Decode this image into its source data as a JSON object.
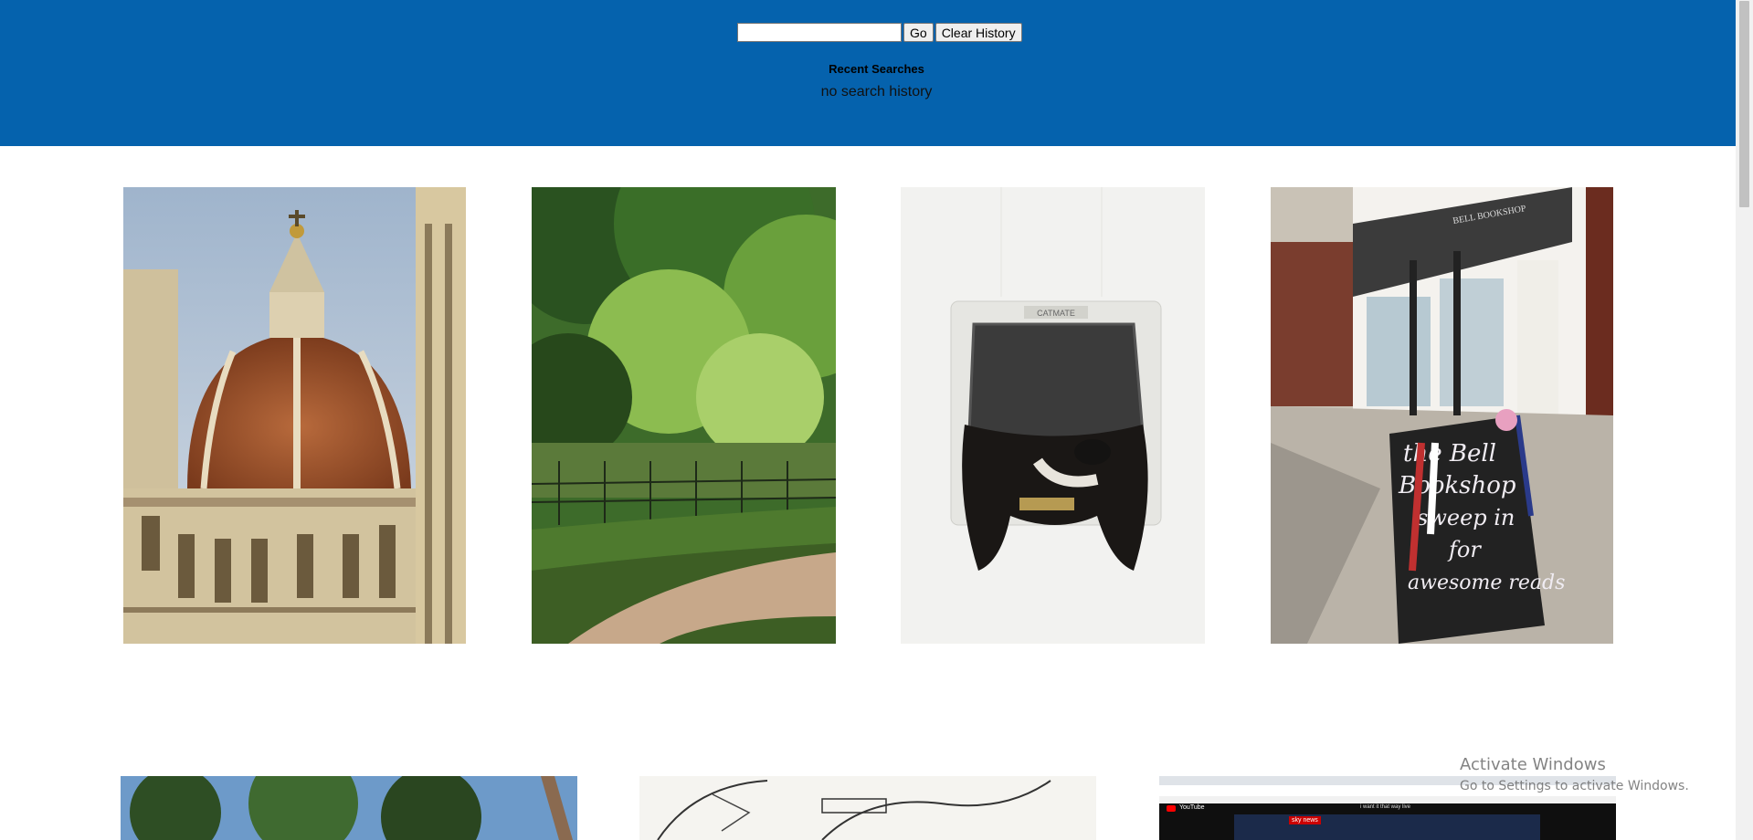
{
  "header": {
    "search_value": "",
    "go_label": "Go",
    "clear_label": "Clear History",
    "recent_title": "Recent Searches",
    "empty_message": "no search history",
    "background_color": "#0562ad"
  },
  "gallery": [
    {
      "name": "photo-florence-cathedral-dome",
      "subject": "Florence cathedral dome"
    },
    {
      "name": "photo-forest-path",
      "subject": "forest path with trees"
    },
    {
      "name": "photo-dog-cat-flap",
      "subject": "dog head through a cat flap"
    },
    {
      "name": "photo-bell-bookshop",
      "subject": "bookshop storefront with chalkboard sign"
    },
    {
      "name": "photo-trees-sky",
      "subject": "trees against the sky"
    },
    {
      "name": "photo-sketch-drawing",
      "subject": "pencil sketch"
    },
    {
      "name": "photo-screenshot-youtube",
      "subject": "screenshot of a browser with YouTube"
    }
  ],
  "photo_text": {
    "catflap_brand": "CATMATE",
    "bookshop_sign": "BELL BOOKSHOP",
    "sign_line1": "the Bell",
    "sign_line2": "Bookshop",
    "sign_line3": "sweep in",
    "sign_line4": "for",
    "sign_line5": "awesome reads",
    "youtube_label": "YouTube",
    "youtube_search": "i want it that way live",
    "sky_news": "sky news"
  },
  "watermark": {
    "line1": "Activate Windows",
    "line2": "Go to Settings to activate Windows."
  }
}
